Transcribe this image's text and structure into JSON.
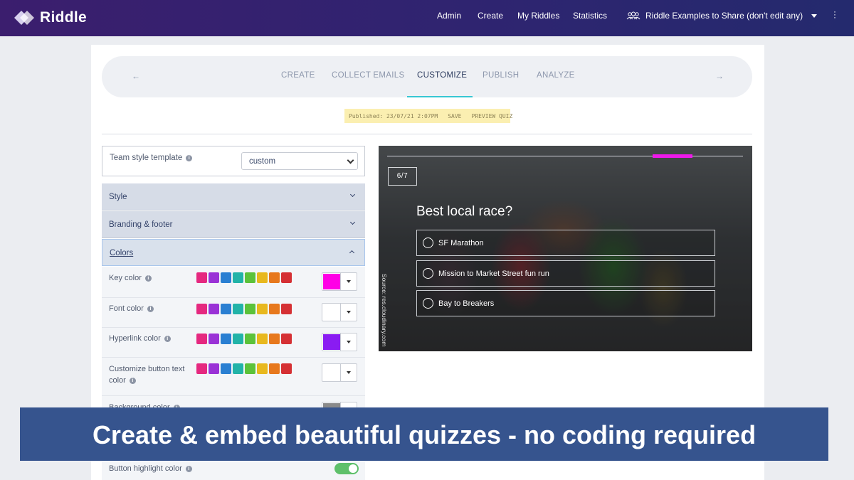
{
  "header": {
    "brand": "Riddle",
    "nav": [
      "Admin",
      "Create",
      "My Riddles",
      "Statistics"
    ],
    "team": "Riddle Examples to Share (don't edit any)"
  },
  "steps": {
    "items": [
      "CREATE",
      "COLLECT EMAILS",
      "CUSTOMIZE",
      "PUBLISH",
      "ANALYZE"
    ],
    "active": "CUSTOMIZE"
  },
  "publish_bar": {
    "status": "Published: 23/07/21 2:07PM",
    "save": "SAVE",
    "preview": "PREVIEW QUIZ"
  },
  "left_panel": {
    "template_label": "Team style template",
    "template_value": "custom",
    "sections": [
      "Style",
      "Branding & footer",
      "Colors"
    ],
    "palette": [
      "#e5287f",
      "#9a32d6",
      "#2a7fd2",
      "#22b3a8",
      "#5cc23a",
      "#e8b81e",
      "#e7781d",
      "#d53034"
    ],
    "color_rows": [
      {
        "label": "Key color",
        "value": "#ff00e6"
      },
      {
        "label": "Font color",
        "value": "#ffffff"
      },
      {
        "label": "Hyperlink color",
        "value": "#8a1cf2"
      },
      {
        "label": "Customize button text color",
        "value": "#ffffff"
      },
      {
        "label": "Background color",
        "value": "#8a8a8a"
      }
    ],
    "highlight_label": "Button highlight color",
    "highlight_on": true
  },
  "preview": {
    "counter": "6/7",
    "progress": 0.857,
    "question": "Best local race?",
    "answers": [
      "SF Marathon",
      "Mission to Market Street fun run",
      "Bay to Breakers"
    ],
    "source": "Source: res.cloudinary.com"
  },
  "banner": {
    "text": "Create & embed beautiful quizzes - no coding required"
  }
}
